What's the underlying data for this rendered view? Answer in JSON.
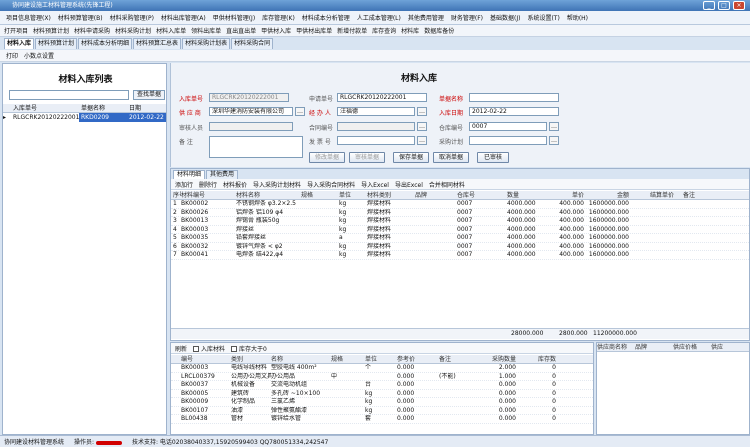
{
  "window": {
    "title": "协同建设施工材料管理系统(先锋工程)"
  },
  "menu": [
    "项目信息管理(X)",
    "材料预算管理(B)",
    "材料采购管理(P)",
    "材料出库管理(A)",
    "甲供材料管理(J)",
    "库存管理(K)",
    "材料成本分析管理",
    "人工成本管理(L)",
    "其他费用管理",
    "财务管理(F)",
    "基础数据(J)",
    "系统设置(T)",
    "帮助(H)"
  ],
  "toolbar": [
    "打开项目",
    "材料预算计划",
    "材料申请采购",
    "材料采购计划",
    "材料入库单",
    "领料出库单",
    "直出直出单",
    "甲供材入库",
    "甲供材出库单",
    "新增付款单",
    "库存查询",
    "材料库",
    "数据库备份"
  ],
  "tabs": [
    "材料入库",
    "材料预算计划",
    "材料成本分析明细",
    "材料预算汇总表",
    "材料采购计划表",
    "材料采购合同"
  ],
  "subtool": [
    "打印",
    "小数点设置"
  ],
  "left": {
    "title": "材料入库列表",
    "search_placeholder": "",
    "search_btn": "查找单据",
    "headers": [
      "入库单号",
      "单据名称",
      "日期"
    ],
    "rows": [
      {
        "no": "RLGCRK20120222001",
        "name": "RKD0209",
        "date": "2012-02-22"
      }
    ]
  },
  "form": {
    "title": "材料入库",
    "rk_no_label": "入库单号",
    "rk_no": "RLGCRK20120222001",
    "apply_no_label": "申请单号",
    "apply_no": "RLGCRK20120222001",
    "bill_name_label": "单据名称",
    "bill_name": "",
    "supplier_label": "供 应 商",
    "supplier": "深圳华建消防安装有限公司",
    "handler_label": "经 办 人",
    "handler": "汪福德",
    "date_label": "入库日期",
    "date": "2012-02-22",
    "check_label": "审核人员",
    "check": "",
    "contract_label": "合同编号",
    "contract": "",
    "warehouse_label": "仓库编号",
    "warehouse": "0007",
    "note_label": "备    注",
    "keeper_label": "发 票 号",
    "keeper": "",
    "plan_label": "采购计划",
    "plan": "",
    "buttons": [
      "修改单据",
      "审核单据",
      "保存单据",
      "取消单据",
      "已审核"
    ]
  },
  "detail": {
    "tabs": [
      "材料明细",
      "其他费用"
    ],
    "tools": [
      "添加行",
      "删除行",
      "材料报价",
      "导入采购计划材料",
      "导入采购合同材料",
      "导入Excel",
      "导出Excel",
      "合并相同材料"
    ],
    "headers": [
      "序号",
      "材料编号",
      "材料名称",
      "规格",
      "单位",
      "材料类别",
      "品牌",
      "仓库号",
      "数量",
      "单价",
      "金额",
      "结算单价",
      "备注"
    ],
    "rows": [
      [
        "1",
        "BK00002",
        "不锈钢焊条 φ3.2×2.5",
        "",
        "kg",
        "焊接材料",
        "",
        "0007",
        "4000.000",
        "400.000",
        "1600000.000",
        "",
        ""
      ],
      [
        "2",
        "BK00026",
        "铝焊条 铝109 φ4",
        "",
        "kg",
        "焊接材料",
        "",
        "0007",
        "4000.000",
        "400.000",
        "1600000.000",
        "",
        ""
      ],
      [
        "3",
        "BK00013",
        "焊锡膏 瓶装50g",
        "",
        "kg",
        "焊接材料",
        "",
        "0007",
        "4000.000",
        "400.000",
        "1600000.000",
        "",
        ""
      ],
      [
        "4",
        "BK00003",
        "焊接丝",
        "",
        "kg",
        "焊接材料",
        "",
        "0007",
        "4000.000",
        "400.000",
        "1600000.000",
        "",
        ""
      ],
      [
        "5",
        "BK00035",
        "铅套焊接丝",
        "",
        "a",
        "焊接材料",
        "",
        "0007",
        "4000.000",
        "400.000",
        "1600000.000",
        "",
        ""
      ],
      [
        "6",
        "BK00032",
        "镀锌气焊条 < φ2",
        "",
        "kg",
        "焊接材料",
        "",
        "0007",
        "4000.000",
        "400.000",
        "1600000.000",
        "",
        ""
      ],
      [
        "7",
        "BK00041",
        "电焊条 结422,φ4",
        "",
        "kg",
        "焊接材料",
        "",
        "0007",
        "4000.000",
        "400.000",
        "1600000.000",
        "",
        ""
      ]
    ],
    "totals": {
      "qty": "28000.000",
      "price": "2800.000",
      "amount": "11200000.000"
    }
  },
  "lower": {
    "tools": [
      "刷新",
      "入库材料",
      "库存大于0"
    ],
    "headers": [
      "编号",
      "类别",
      "名称",
      "规格",
      "单位",
      "参考价",
      "备注",
      "采购数量",
      "库存数"
    ],
    "rows": [
      [
        "BK00003",
        "电线导线材料",
        "塑胶电线 400m²",
        "",
        "个",
        "0.000",
        "",
        "2.000",
        "0"
      ],
      [
        "LRCL00379",
        "公用办公用文具",
        "办公用品",
        "中",
        "",
        "0.000",
        "(不能)",
        "1.000",
        "0"
      ],
      [
        "BK00037",
        "机械设备",
        "交流电动机组",
        "",
        "台",
        "0.000",
        "",
        "0.000",
        "0"
      ],
      [
        "BK00005",
        "建筑砖",
        "多孔砖 ~10×100",
        "",
        "kg",
        "0.000",
        "",
        "0.000",
        "0"
      ],
      [
        "BK00009",
        "化学制品",
        "三氯乙烯",
        "",
        "kg",
        "0.000",
        "",
        "0.000",
        "0"
      ],
      [
        "BK00107",
        "油漆",
        "弹性聚氨酯漆",
        "",
        "kg",
        "0.000",
        "",
        "0.000",
        "0"
      ],
      [
        "BL00438",
        "管材",
        "镀锌给水管",
        "",
        "套",
        "0.000",
        "",
        "0.000",
        "0"
      ]
    ]
  },
  "side": {
    "headers": [
      "供应商名称",
      "品牌",
      "供应价格",
      "供应"
    ]
  },
  "status": {
    "app": "协同建设材料管理系统",
    "operator_label": "操作员:",
    "support": "技术支持: 电话02038040337,15920599403 QQ780051334,242547"
  }
}
